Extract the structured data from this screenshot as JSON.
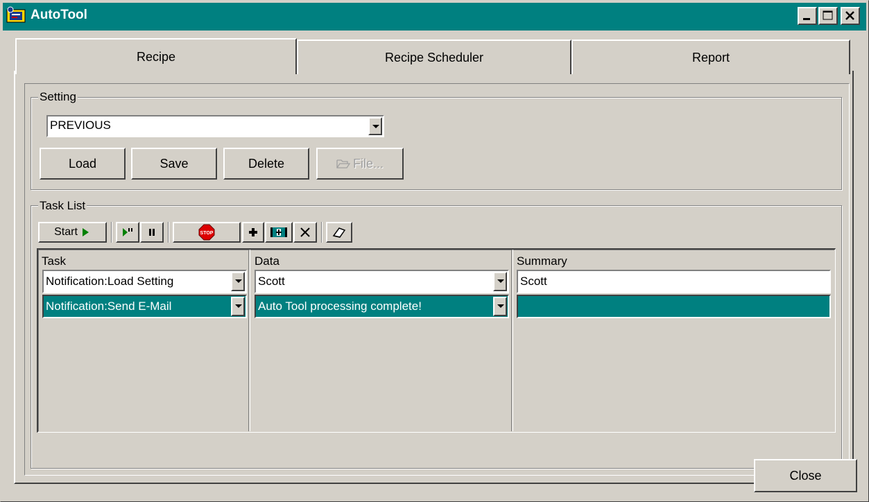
{
  "window": {
    "title": "AutoTool"
  },
  "tabs": [
    {
      "label": "Recipe",
      "active": true
    },
    {
      "label": "Recipe Scheduler",
      "active": false
    },
    {
      "label": "Report",
      "active": false
    }
  ],
  "setting": {
    "group_label": "Setting",
    "selected": "PREVIOUS",
    "buttons": {
      "load": "Load",
      "save": "Save",
      "delete": "Delete",
      "file": "File..."
    }
  },
  "task_list": {
    "group_label": "Task List",
    "toolbar": {
      "start": "Start"
    },
    "columns": {
      "task": "Task",
      "data": "Data",
      "summary": "Summary"
    },
    "rows": [
      {
        "task": "Notification:Load Setting",
        "data": "Scott",
        "summary": "Scott",
        "selected": false
      },
      {
        "task": "Notification:Send E-Mail",
        "data": "Auto Tool processing complete!",
        "summary": "",
        "selected": true
      }
    ]
  },
  "footer": {
    "close": "Close"
  },
  "colors": {
    "title_bar": "#008080",
    "selection": "#008080",
    "face": "#d4d0c8"
  }
}
